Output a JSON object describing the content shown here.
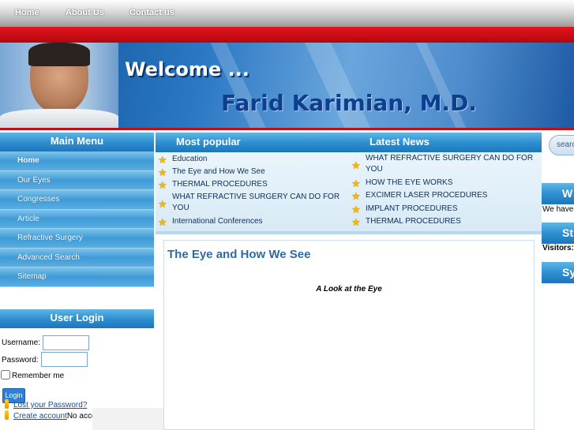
{
  "nav": {
    "home": "Home",
    "about": "About Us",
    "contact": "Contact us"
  },
  "banner": {
    "welcome": "Welcome ...",
    "name": "Farid Karimian, M.D."
  },
  "main_menu": {
    "title": "Main Menu",
    "items": [
      {
        "label": "Home"
      },
      {
        "label": "Our Eyes"
      },
      {
        "label": "Congresses"
      },
      {
        "label": "Article"
      },
      {
        "label": "Refractive Surgery"
      },
      {
        "label": "Advanced Search"
      },
      {
        "label": "Sitemap"
      }
    ]
  },
  "login": {
    "title": "User Login",
    "username_label": "Username:",
    "password_label": "Password:",
    "remember_label": "Remember me",
    "button": "Login",
    "lost_password": "Lost your Password?",
    "create_account": "Create account",
    "no_account": "No account yet?"
  },
  "most_popular": {
    "title": "Most popular",
    "items": [
      "Education",
      "The Eye and How We See",
      "THERMAL PROCEDURES",
      "WHAT REFRACTIVE SURGERY CAN DO FOR YOU",
      "International Conferences"
    ]
  },
  "latest_news": {
    "title": "Latest News",
    "items": [
      "WHAT REFRACTIVE SURGERY CAN DO FOR YOU",
      "HOW THE EYE WORKS",
      "EXCIMER LASER PROCEDURES",
      "IMPLANT PROCEDURES",
      "THERMAL PROCEDURES"
    ]
  },
  "article": {
    "title": "The Eye and How We See",
    "subtitle": "A Look at the Eye"
  },
  "right": {
    "search_placeholder": "search...",
    "head1": "W",
    "text1": "We have",
    "head2": "St",
    "text2": "Visitors:",
    "head3": "Sy"
  },
  "colors": {
    "accent_blue": "#2f8fd0",
    "red_bar": "#c10d13",
    "title_blue": "#2b6ca6"
  }
}
